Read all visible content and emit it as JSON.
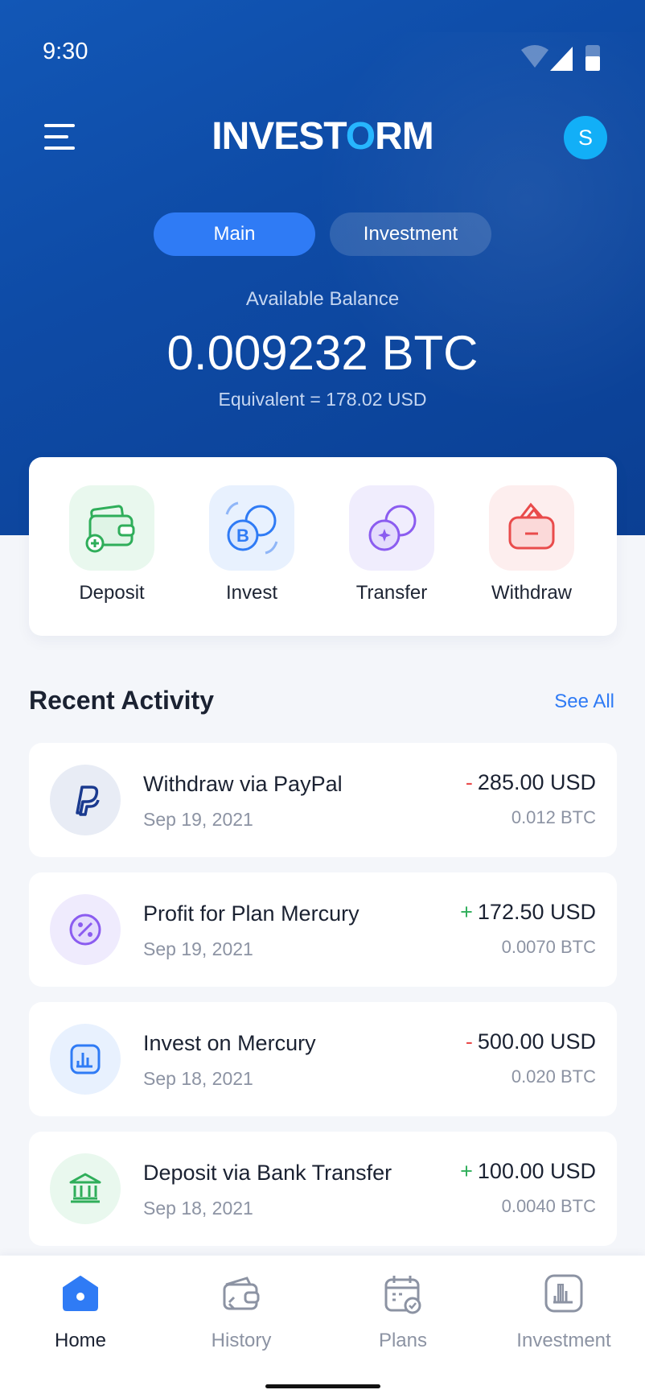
{
  "status_bar": {
    "time": "9:30"
  },
  "header": {
    "brand_prefix": "INVEST",
    "brand_o": "O",
    "brand_suffix": "RM",
    "avatar_initial": "S"
  },
  "tabs": [
    {
      "label": "Main",
      "active": true
    },
    {
      "label": "Investment",
      "active": false
    }
  ],
  "balance": {
    "label": "Available Balance",
    "value": "0.009232 BTC",
    "equivalent": "Equivalent =  178.02 USD"
  },
  "quick_actions": [
    {
      "label": "Deposit",
      "icon": "wallet-add-icon",
      "color": "#2fae5a"
    },
    {
      "label": "Invest",
      "icon": "coins-bitcoin-icon",
      "color": "#2f7bf5"
    },
    {
      "label": "Transfer",
      "icon": "coins-transfer-icon",
      "color": "#8b5cf0"
    },
    {
      "label": "Withdraw",
      "icon": "wallet-minus-icon",
      "color": "#e94b4b"
    }
  ],
  "recent_activity": {
    "title": "Recent Activity",
    "see_all": "See All",
    "items": [
      {
        "title": "Withdraw via PayPal",
        "date": "Sep 19, 2021",
        "sign": "-",
        "amount": "285.00 USD",
        "btc": "0.012 BTC",
        "icon": "paypal-icon"
      },
      {
        "title": "Profit for Plan Mercury",
        "date": "Sep 19, 2021",
        "sign": "+",
        "amount": "172.50 USD",
        "btc": "0.0070 BTC",
        "icon": "percent-icon"
      },
      {
        "title": "Invest on Mercury",
        "date": "Sep 18, 2021",
        "sign": "-",
        "amount": "500.00 USD",
        "btc": "0.020 BTC",
        "icon": "bar-chart-icon"
      },
      {
        "title": "Deposit via Bank Transfer",
        "date": "Sep 18, 2021",
        "sign": "+",
        "amount": "100.00 USD",
        "btc": "0.0040 BTC",
        "icon": "bank-icon"
      }
    ]
  },
  "bottom_nav": [
    {
      "label": "Home",
      "icon": "home-icon",
      "active": true
    },
    {
      "label": "History",
      "icon": "history-icon",
      "active": false
    },
    {
      "label": "Plans",
      "icon": "calendar-icon",
      "active": false
    },
    {
      "label": "Investment",
      "icon": "chart-icon",
      "active": false
    }
  ],
  "colors": {
    "primary": "#2f7bf5",
    "header_bg": "#0e4ba6",
    "positive": "#2fae5a",
    "negative": "#e94b4b"
  }
}
